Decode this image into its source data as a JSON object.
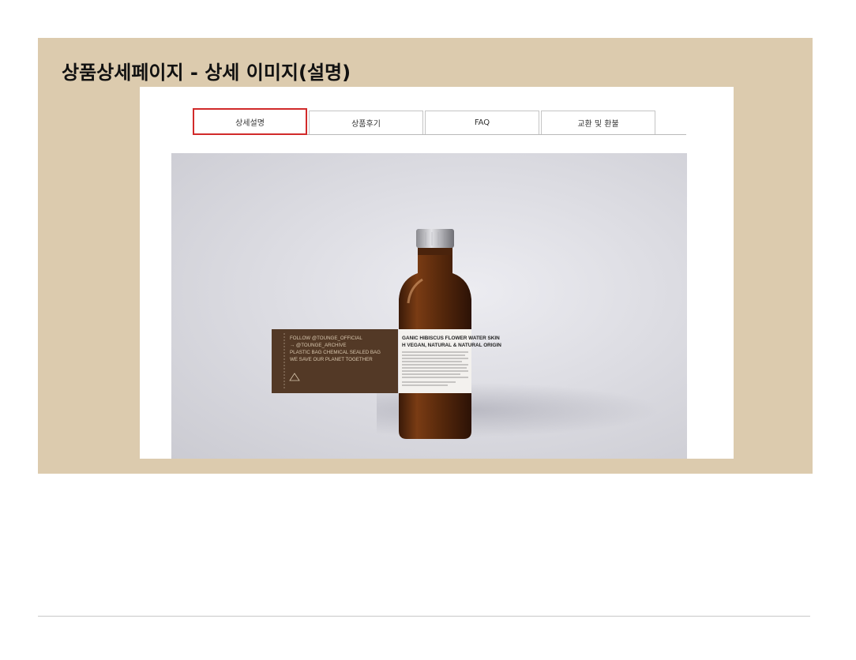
{
  "slide": {
    "title": "상품상세페이지 - 상세 이미지(설명)"
  },
  "tabs": [
    {
      "label": "상세설명",
      "active": true
    },
    {
      "label": "상품후기",
      "active": false
    },
    {
      "label": "FAQ",
      "active": false
    },
    {
      "label": "교환 및 환불",
      "active": false
    }
  ],
  "product_image": {
    "card_lines": [
      "FOLLOW @TOUNGE_OFFICIAL",
      "→ @TOUNGE_ARCHIVE",
      "PLASTIC BAG CHEMICAL SEALED BAG",
      "WE SAVE OUR PLANET TOGETHER"
    ],
    "bottle_label": [
      "GANIC HIBISCUS FLOWER WATER SKIN",
      "H VEGAN, NATURAL & NATURAL ORIGIN"
    ]
  },
  "colors": {
    "panel_background": "#dccbae",
    "active_tab_border": "#d12a2a"
  }
}
